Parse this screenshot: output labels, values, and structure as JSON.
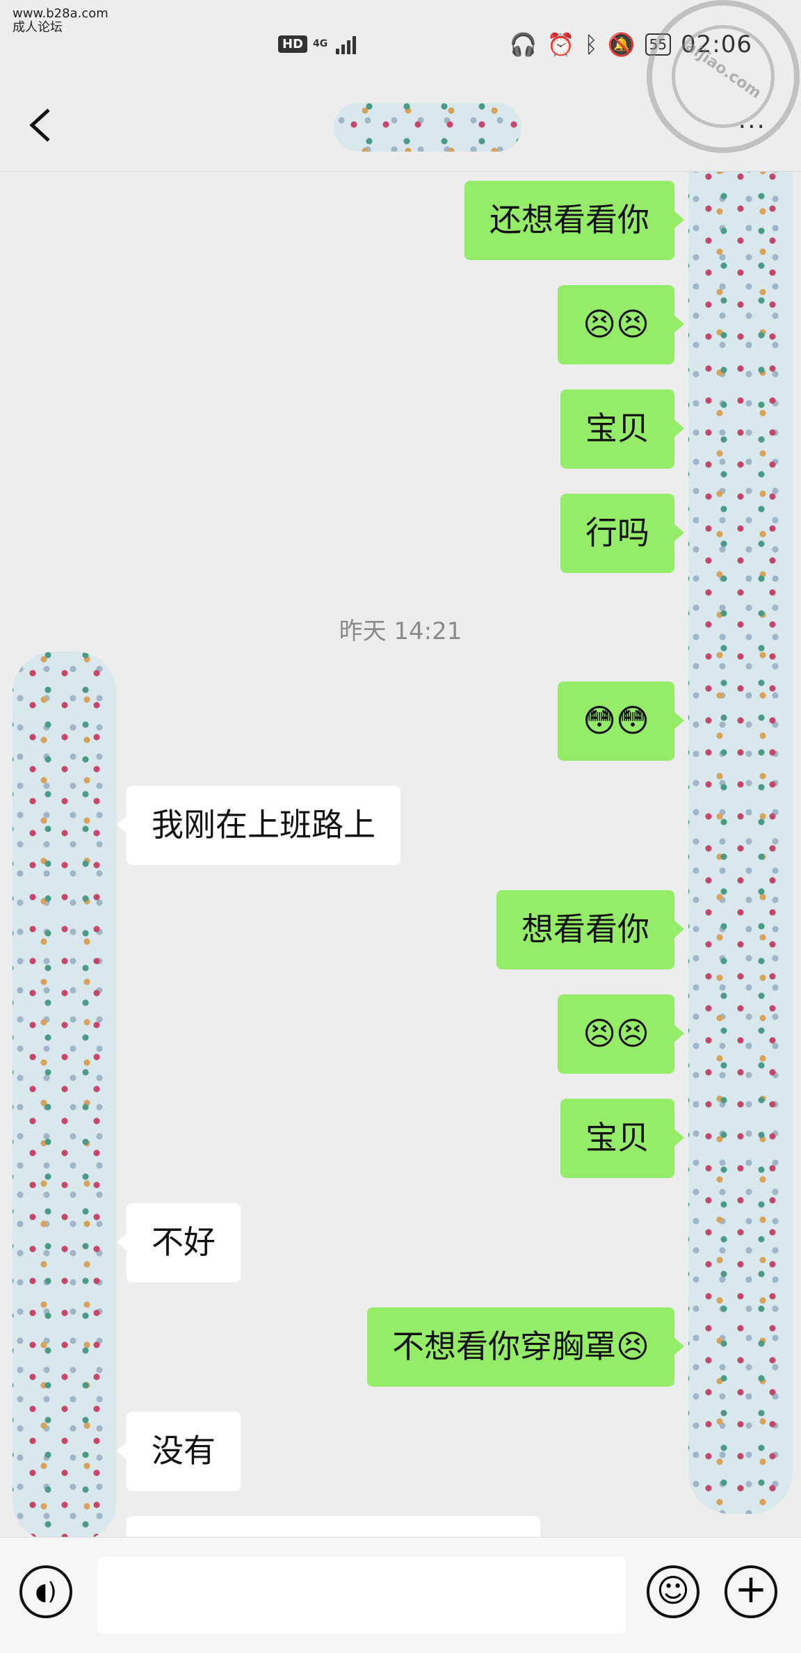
{
  "watermark": {
    "site": "www.b28a.com",
    "caption": "成人论坛",
    "stamp_text": "aijiao.com"
  },
  "statusbar": {
    "hd": "HD",
    "network": "4G",
    "battery": "55",
    "time": "02:06"
  },
  "navbar": {
    "back_icon": "chevron-left-icon",
    "more_label": "···"
  },
  "chat": {
    "timestamp": "昨天 14:21",
    "messages": [
      {
        "side": "me",
        "text": "还想看看你"
      },
      {
        "side": "me",
        "text": "😣😣"
      },
      {
        "side": "me",
        "text": "宝贝"
      },
      {
        "side": "me",
        "text": "行吗"
      },
      {
        "side": "me",
        "text": "😳😳"
      },
      {
        "side": "other",
        "text": "我刚在上班路上"
      },
      {
        "side": "me",
        "text": "想看看你"
      },
      {
        "side": "me",
        "text": "😣😣"
      },
      {
        "side": "me",
        "text": "宝贝"
      },
      {
        "side": "other",
        "text": "不好"
      },
      {
        "side": "me",
        "text": "不想看你穿胸罩😣"
      },
      {
        "side": "other",
        "text": "没有"
      }
    ]
  },
  "colors": {
    "me_bubble": "#95ec69",
    "other_bubble": "#ffffff",
    "background": "#ededed"
  },
  "inputbar": {
    "voice_icon": "voice-icon",
    "emoji_icon": "emoji-icon",
    "plus_icon": "plus-icon"
  }
}
